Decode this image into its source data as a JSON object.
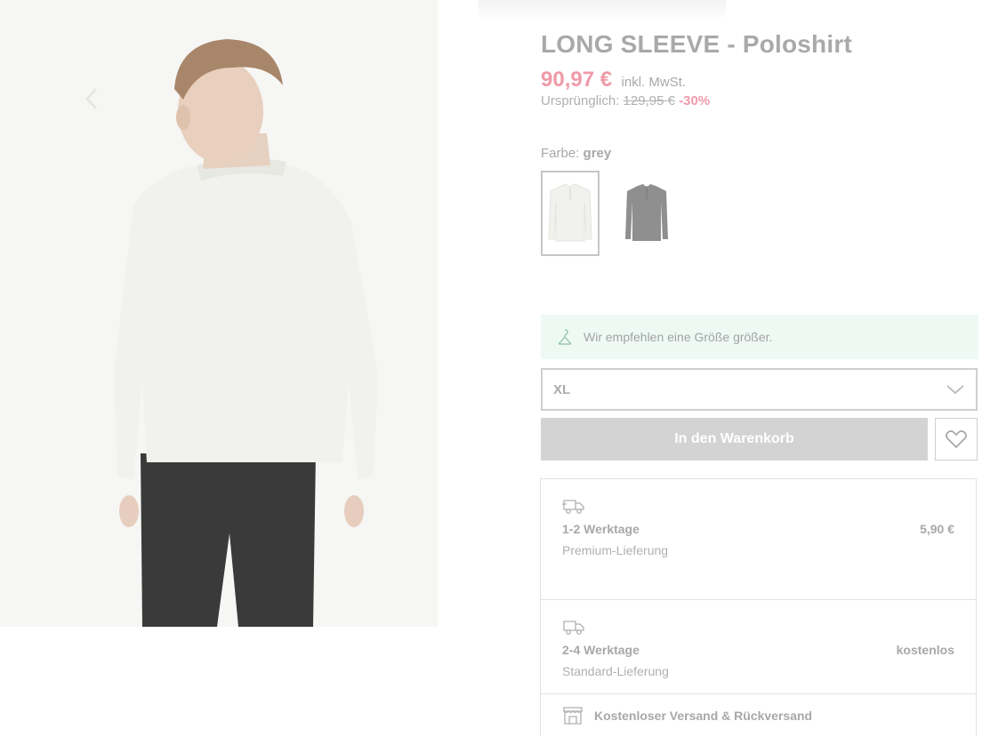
{
  "product": {
    "title": "LONG SLEEVE - Poloshirt",
    "price": "90,97 €",
    "vat_note": "inkl. MwSt.",
    "original_label": "Ursprünglich:",
    "original_price": "129,95 €",
    "discount": "-30%"
  },
  "color": {
    "label": "Farbe:",
    "value": "grey",
    "swatches": [
      {
        "name": "grey",
        "shirt_color": "#f1f1ee",
        "selected": true
      },
      {
        "name": "dark",
        "shirt_color": "#8f8f8f",
        "selected": false
      }
    ]
  },
  "size_hint": {
    "icon": "hanger-icon",
    "text": "Wir empfehlen eine Größe größer."
  },
  "size_select": {
    "value": "XL",
    "icon": "chevron-down-icon"
  },
  "actions": {
    "cart_label": "In den Warenkorb",
    "wishlist_icon": "heart-icon"
  },
  "delivery": {
    "premium": {
      "days": "1-2 Werktage",
      "type": "Premium-Lieferung",
      "cost": "5,90 €",
      "icon": "truck-icon"
    },
    "standard": {
      "days": "2-4 Werktage",
      "type": "Standard-Lieferung",
      "cost": "kostenlos",
      "icon": "truck-icon"
    },
    "free_shipping": {
      "text": "Kostenloser Versand & Rückversand",
      "icon": "store-icon"
    }
  },
  "colors": {
    "price": "#ef9aa8",
    "hint_bg": "#eef9f4",
    "button_bg": "#d3d3d3"
  }
}
